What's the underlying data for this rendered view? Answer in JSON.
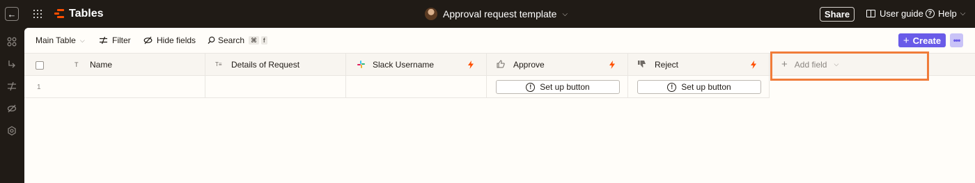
{
  "topbar": {
    "app_title": "Tables",
    "doc_title": "Approval request template",
    "share_label": "Share",
    "user_guide_label": "User guide",
    "help_label": "Help",
    "back_glyph": "←",
    "caret_glyph": "⌵"
  },
  "toolbar": {
    "view_label": "Main Table",
    "filter_label": "Filter",
    "hide_fields_label": "Hide fields",
    "search_label": "Search",
    "search_shortcut_key1": "⌘",
    "search_shortcut_key2": "f",
    "create_label": "Create",
    "more_label": "•••"
  },
  "table": {
    "columns": [
      {
        "label": "Name",
        "type_icon": "T"
      },
      {
        "label": "Details of Request",
        "type_icon": "T≡"
      },
      {
        "label": "Slack Username",
        "type_icon": "slack-icon"
      },
      {
        "label": "Approve",
        "type_icon": "thumbs-up-icon"
      },
      {
        "label": "Reject",
        "type_icon": "thumbs-down-icon"
      }
    ],
    "add_field_label": "Add field",
    "rows": [
      {
        "number": "1",
        "approve_button": "Set up button",
        "reject_button": "Set up button"
      }
    ]
  },
  "colors": {
    "brand": "#ff4f00",
    "create_button": "#695be8",
    "highlight_box": "#f07c3a",
    "bolt": "#ff4f00"
  }
}
